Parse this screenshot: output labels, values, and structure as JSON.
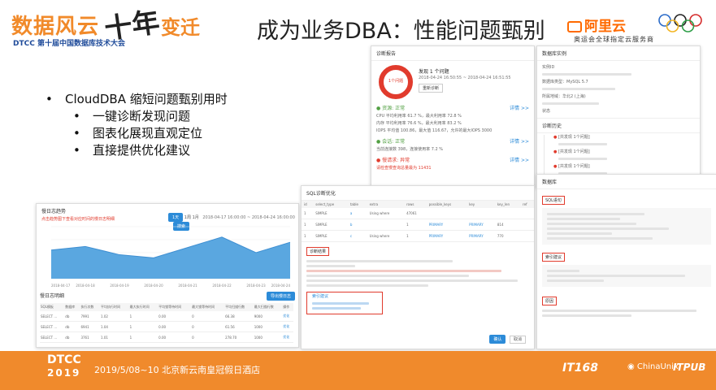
{
  "header": {
    "logo_main": "数据风云",
    "logo_ten": "十年",
    "logo_change": "变迁",
    "logo_sub_dtcc": "DTCC",
    "logo_sub": "第十届中国数据库技术大会",
    "title": "成为业务DBA：性能问题甄别",
    "aliyun": "阿里云",
    "aliyun_sub": "奥运会全球指定云服务商"
  },
  "bullets": {
    "main": "CloudDBA 缩短问题甄别用时",
    "items": [
      "一键诊断发现问题",
      "图表化展现直观定位",
      "直接提供优化建议"
    ]
  },
  "diag_report": {
    "title": "诊断报告",
    "found": "发现 1 个问题",
    "time_range": "2018-04-24 16:50:55 ~ 2018-04-24 16:51:55",
    "gauge_label": "1个问题",
    "rediagnose": "重新诊断",
    "detail": "详情 >>",
    "sections": [
      {
        "status": "资源: 正常",
        "cls": "ok"
      },
      {
        "status": "会话: 正常",
        "cls": "ok"
      },
      {
        "status": "慢请求: 异常",
        "cls": "bad"
      }
    ],
    "resource_lines": [
      "CPU 平均利用率 61.7 %，最大利用率 72.8 %",
      "内存 平均利用率 76.6 %，最大利用率 83.2 %",
      "IOPS 平均值 100.86，最大值 116.67，允许的最大IOPS 3000"
    ],
    "session_line": "当前连接数 398，连接使用率 7.2 %",
    "slow_line": "请检查慢查询总量最为 11431"
  },
  "instance": {
    "title": "数据库实例",
    "fields": [
      "实例ID",
      "数据库类型：MySQL 5.7",
      "所属地域：华北2 (上海)",
      "状态"
    ],
    "history_title": "诊断历史",
    "history_item": "[共发现 1个问题]"
  },
  "chart": {
    "title": "慢日志趋势",
    "note": "点击趋势图下查看对应时间的慢日志明细",
    "search": "搜索",
    "date_range": "2018-04-17 16:00:00 ~ 2018-04-24 16:00:00",
    "tabs": [
      "1天",
      "1周",
      "1月"
    ],
    "xticks": [
      "2018-04-17",
      "2018-04-18",
      "2018-04-19",
      "2018-04-20",
      "2018-04-21",
      "2018-04-22",
      "2018-04-23",
      "2018-04-24"
    ]
  },
  "chart_data": {
    "type": "area",
    "x": [
      "2018-04-17",
      "2018-04-18",
      "2018-04-19",
      "2018-04-20",
      "2018-04-21",
      "2018-04-22",
      "2018-04-23",
      "2018-04-24"
    ],
    "values": [
      55,
      62,
      46,
      40,
      60,
      80,
      50,
      70
    ],
    "ylim": [
      0,
      100
    ],
    "colors": {
      "fill": "#5aa7e0",
      "line": "#3f8fd2"
    },
    "grid": true
  },
  "slow_table": {
    "title": "慢日志明细",
    "action": "导出慢日志",
    "headers": [
      "SQL模板",
      "数据库",
      "执行次数",
      "平均执行时间",
      "最大执行时间",
      "平均锁等待时间",
      "最大锁等待时间",
      "平均扫描行数",
      "最大扫描行数",
      "操作"
    ],
    "rows": [
      [
        "SELECT ...",
        "db",
        "7991",
        "1.02",
        "1",
        "0.00",
        "0",
        "66.38",
        "9000",
        "优化"
      ],
      [
        "SELECT ...",
        "db",
        "6941",
        "1.04",
        "1",
        "0.00",
        "0",
        "61.56",
        "1000",
        "优化"
      ],
      [
        "SELECT ...",
        "db",
        "3761",
        "1.01",
        "1",
        "0.00",
        "0",
        "278.70",
        "1000",
        "优化"
      ]
    ]
  },
  "sql_diag": {
    "title": "SQL诊断优化",
    "headers": [
      "id",
      "select_type",
      "table",
      "extra",
      "rows",
      "possible_keys",
      "key",
      "key_len",
      "ref"
    ],
    "rows": [
      [
        "1",
        "SIMPLE",
        "a",
        "Using where",
        "47061",
        "",
        "",
        "",
        ""
      ],
      [
        "1",
        "SIMPLE",
        "b",
        "",
        "1",
        "PRIMARY",
        "PRIMARY",
        "814",
        ""
      ],
      [
        "1",
        "SIMPLE",
        "c",
        "Using where",
        "1",
        "PRIMARY",
        "PRIMARY",
        "770",
        ""
      ]
    ],
    "result_label": "诊断结果",
    "suggest_label": "索引建议",
    "confirm": "确认",
    "cancel": "取消"
  },
  "right_panel": {
    "title": "数据库",
    "sql_label": "SQL语句",
    "index_label": "索引建议",
    "reason_label": "原因"
  },
  "footer": {
    "dtcc": "DTCC",
    "year": "2019",
    "date_venue": "2019/5/08~10  北京新云南皇冠假日酒店",
    "sponsor1": "IT168",
    "sponsor2": "ChinaUnix",
    "sponsor3": "ITPUB"
  }
}
